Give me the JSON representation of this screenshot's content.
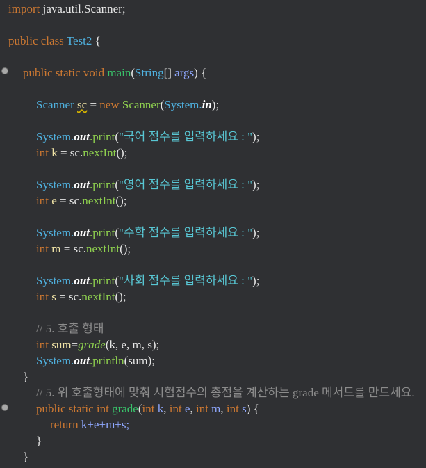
{
  "code": {
    "l1_import": "import",
    "l1_pkg": "java.util.Scanner;",
    "l2_public": "public",
    "l2_class": "class",
    "l2_name": "Test2",
    "l2_brace": "{",
    "l3_mods": "public static void",
    "l3_main": "main",
    "l3_open": "(",
    "l3_string": "String",
    "l3_arr": "[]",
    "l3_args": "args",
    "l3_close": ") {",
    "l4_scanner": "Scanner",
    "l4_sc": "sc",
    "l4_eq": "=",
    "l4_new": "new",
    "l4_scanner2": "Scanner",
    "l4_open": "(",
    "l4_system": "System.",
    "l4_in": "in",
    "l4_close": ");",
    "system": "System.",
    "out": "out",
    "print": ".print",
    "open_paren": "(",
    "close_paren": ");",
    "str_kor": "\"국어 점수를 입력하세요 : \"",
    "str_eng": "\"영어 점수를 입력하세요 : \"",
    "str_math": "\"수학 점수를 입력하세요 : \"",
    "str_soc": "\"사회 점수를 입력하세요 : \"",
    "int_kw": "int",
    "var_k": "k",
    "var_e": "e",
    "var_m": "m",
    "var_s": "s",
    "assign": "=",
    "sc_dot": "sc.",
    "nextInt": "nextInt",
    "call_end": "();",
    "comment1": "// 5. 호출 형태",
    "l_sum_int": "int",
    "l_sum_var": "sum",
    "l_sum_eq": "=",
    "l_sum_grade": "grade",
    "l_sum_args": "(k, e, m, s);",
    "println": ".println",
    "println_arg": "(sum);",
    "close_brace": "}",
    "comment2": "// 5. 위 호출형태에 맞춰 시험점수의 총점을 계산하는 grade 메서드를 만드세요.",
    "g_mods": "public static int",
    "g_name": "grade",
    "g_open": "(",
    "g_int": "int",
    "g_comma": ",",
    "g_close": ") {",
    "ret_kw": "return",
    "ret_expr": "k+e+m+s;"
  }
}
